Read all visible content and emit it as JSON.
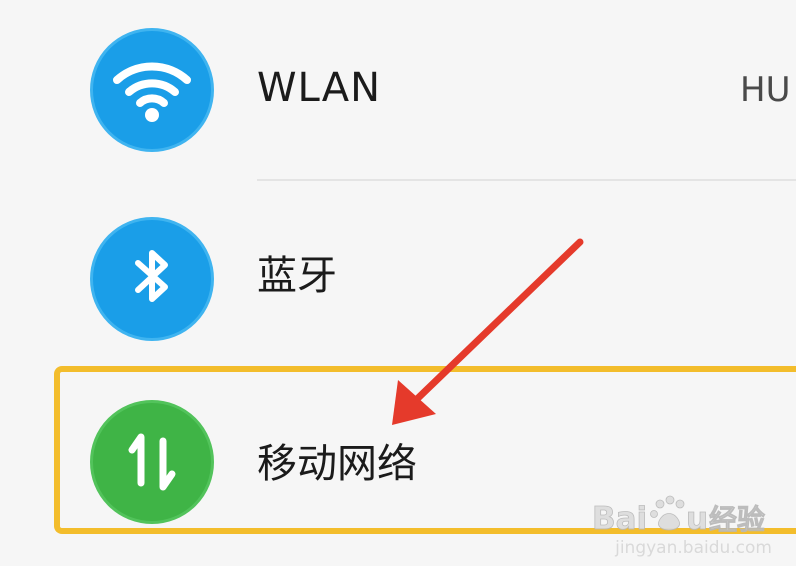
{
  "settings": {
    "items": [
      {
        "label": "WLAN",
        "value": "HU",
        "icon": "wifi-icon",
        "icon_color": "#1a9ee8"
      },
      {
        "label": "蓝牙",
        "icon": "bluetooth-icon",
        "icon_color": "#1a9ee8"
      },
      {
        "label": "移动网络",
        "icon": "mobile-data-icon",
        "icon_color": "#3fb446"
      }
    ]
  },
  "annotations": {
    "highlight_color": "#f3bd2c",
    "arrow_color": "#e53a2b"
  },
  "watermark": {
    "logo_text": "Baidu经验",
    "url": "jingyan.baidu.com"
  }
}
